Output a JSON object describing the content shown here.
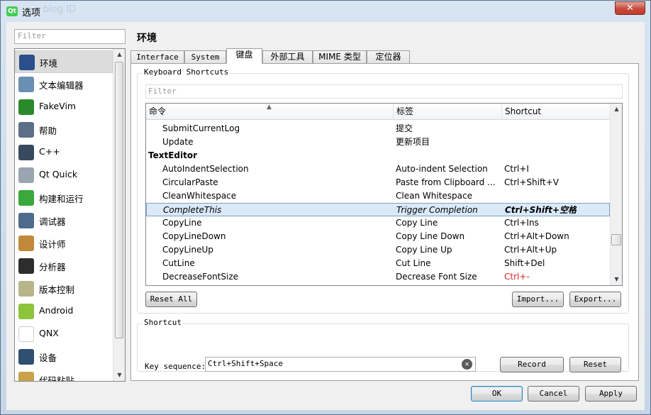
{
  "window": {
    "title": "选项",
    "title_ghost": "blog ID",
    "app_icon": "Qt",
    "close_glyph": "✕"
  },
  "left": {
    "filter_placeholder": "Filter",
    "categories": [
      {
        "label": "环境",
        "icon": "environment-icon",
        "color": "#2b4f8a"
      },
      {
        "label": "文本编辑器",
        "icon": "text-editor-icon",
        "color": "#6b8fb3"
      },
      {
        "label": "FakeVim",
        "icon": "fakevim-icon",
        "color": "#2a8a2a"
      },
      {
        "label": "帮助",
        "icon": "help-icon",
        "color": "#5d6f86"
      },
      {
        "label": "C++",
        "icon": "cpp-icon",
        "color": "#3a4a5e"
      },
      {
        "label": "Qt Quick",
        "icon": "qt-quick-icon",
        "color": "#9aa5b0"
      },
      {
        "label": "构建和运行",
        "icon": "build-run-icon",
        "color": "#3aa83a"
      },
      {
        "label": "调试器",
        "icon": "debugger-icon",
        "color": "#4d6b8c"
      },
      {
        "label": "设计师",
        "icon": "designer-icon",
        "color": "#c08a3a"
      },
      {
        "label": "分析器",
        "icon": "analyzer-icon",
        "color": "#2d2d2d"
      },
      {
        "label": "版本控制",
        "icon": "version-control-icon",
        "color": "#b8b48a"
      },
      {
        "label": "Android",
        "icon": "android-icon",
        "color": "#8cc43c"
      },
      {
        "label": "QNX",
        "icon": "qnx-icon",
        "color": "#ffffff"
      },
      {
        "label": "设备",
        "icon": "devices-icon",
        "color": "#2f4f73"
      },
      {
        "label": "代码粘贴",
        "icon": "code-paste-icon",
        "color": "#c9a34a"
      }
    ]
  },
  "section_title": "环境",
  "tabs": [
    {
      "label": "Interface"
    },
    {
      "label": "System"
    },
    {
      "label": "键盘"
    },
    {
      "label": "外部工具"
    },
    {
      "label": "MIME 类型"
    },
    {
      "label": "定位器"
    }
  ],
  "shortcuts": {
    "group_title": "Keyboard Shortcuts",
    "filter_placeholder": "Filter",
    "columns": [
      "命令",
      "标签",
      "Shortcut"
    ],
    "rows": [
      {
        "command": "SubmitCurrentLog",
        "label": "提交",
        "shortcut": ""
      },
      {
        "command": "Update",
        "label": "更新项目",
        "shortcut": ""
      },
      {
        "command": "TextEditor",
        "label": "",
        "shortcut": "",
        "group": true
      },
      {
        "command": "AutoIndentSelection",
        "label": "Auto-indent Selection",
        "shortcut": "Ctrl+I"
      },
      {
        "command": "CircularPaste",
        "label": "Paste from Clipboard ...",
        "shortcut": "Ctrl+Shift+V"
      },
      {
        "command": "CleanWhitespace",
        "label": "Clean Whitespace",
        "shortcut": ""
      },
      {
        "command": "CompleteThis",
        "label": "Trigger Completion",
        "shortcut": "Ctrl+Shift+空格",
        "selected": true
      },
      {
        "command": "CopyLine",
        "label": "Copy Line",
        "shortcut": "Ctrl+Ins"
      },
      {
        "command": "CopyLineDown",
        "label": "Copy Line Down",
        "shortcut": "Ctrl+Alt+Down"
      },
      {
        "command": "CopyLineUp",
        "label": "Copy Line Up",
        "shortcut": "Ctrl+Alt+Up"
      },
      {
        "command": "CutLine",
        "label": "Cut Line",
        "shortcut": "Shift+Del"
      },
      {
        "command": "DecreaseFontSize",
        "label": "Decrease Font Size",
        "shortcut": "Ctrl+-",
        "conflict": true
      }
    ],
    "conflict_color": "#e02020",
    "reset_all": "Reset All",
    "import": "Import...",
    "export": "Export..."
  },
  "shortcut_group": {
    "title": "Shortcut",
    "key_sequence_label": "Key sequence:",
    "key_sequence_value": "Ctrl+Shift+Space",
    "clear_glyph": "✕",
    "record": "Record",
    "reset": "Reset"
  },
  "footer": {
    "ok": "OK",
    "cancel": "Cancel",
    "apply": "Apply"
  },
  "scroll_glyphs": {
    "up": "▲",
    "down": "▼",
    "sort": "▲"
  }
}
